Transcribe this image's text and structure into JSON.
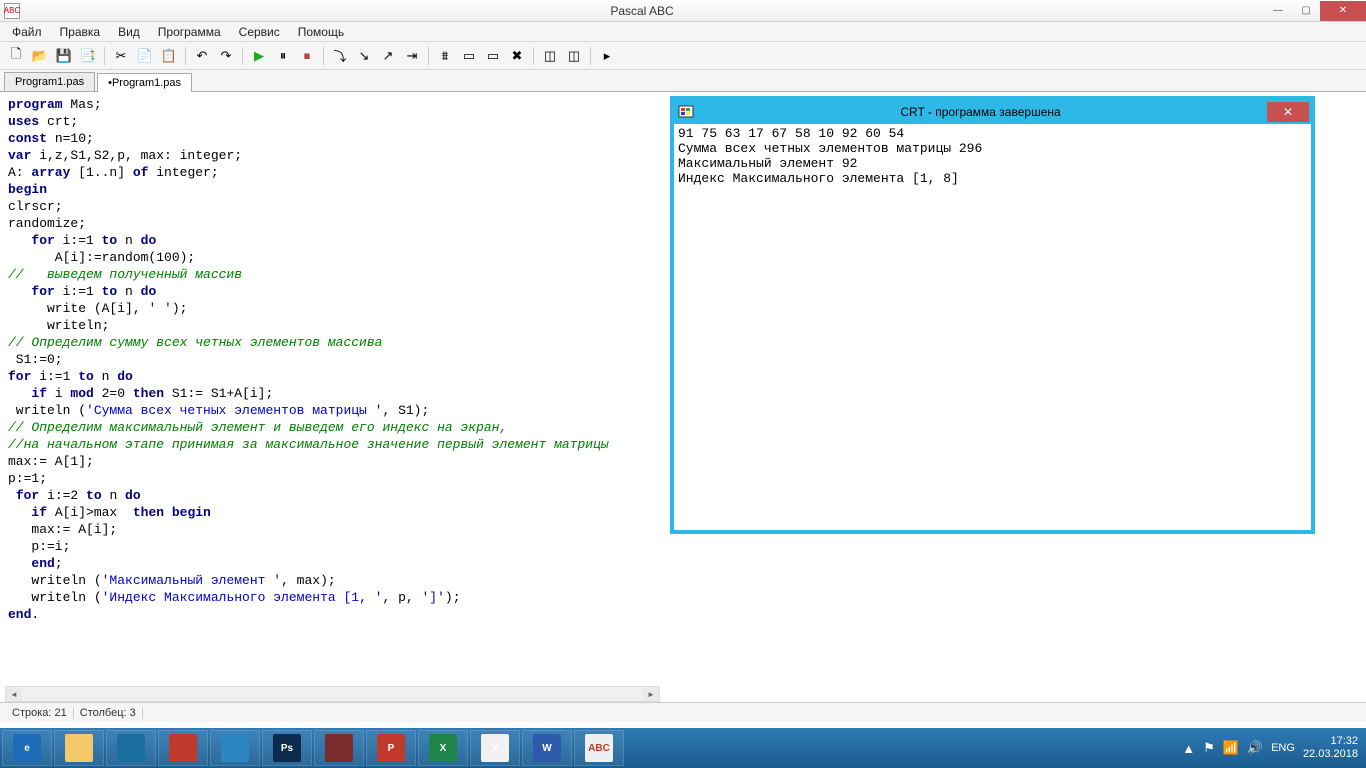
{
  "window": {
    "title": "Pascal ABC",
    "icon_label": "ABC"
  },
  "menu": [
    "Файл",
    "Правка",
    "Вид",
    "Программа",
    "Сервис",
    "Помощь"
  ],
  "tabs": [
    {
      "label": "Program1.pas",
      "active": false
    },
    {
      "label": "•Program1.pas",
      "active": true
    }
  ],
  "code_lines": [
    {
      "t": "program Mas;",
      "cls": "kw-mix",
      "raw": "<span class='kw'>program</span> Mas;"
    },
    {
      "raw": "<span class='kw'>uses</span> crt;"
    },
    {
      "raw": "<span class='kw'>const</span> n=10;"
    },
    {
      "raw": "<span class='kw'>var</span> i,z,S1,S2,p, max: integer;"
    },
    {
      "raw": "A: <span class='kw'>array</span> [1..n] <span class='kw'>of</span> integer;"
    },
    {
      "raw": "<span class='kw'>begin</span>"
    },
    {
      "raw": "clrscr;"
    },
    {
      "raw": "randomize;"
    },
    {
      "raw": "   <span class='kw'>for</span> i:=1 <span class='kw'>to</span> n <span class='kw'>do</span>"
    },
    {
      "raw": "      A[i]:=random(100);"
    },
    {
      "raw": "<span class='cm'>//   выведем полученный массив</span>"
    },
    {
      "raw": "   <span class='kw'>for</span> i:=1 <span class='kw'>to</span> n <span class='kw'>do</span>"
    },
    {
      "raw": "     write (A[i], <span class='st'>' '</span>);"
    },
    {
      "raw": "     writeln;"
    },
    {
      "raw": "<span class='cm'>// Определим сумму всех четных элементов массива</span>"
    },
    {
      "raw": " S1:=0;"
    },
    {
      "raw": "<span class='kw'>for</span> i:=1 <span class='kw'>to</span> n <span class='kw'>do</span>"
    },
    {
      "raw": "   <span class='kw'>if</span> i <span class='kw'>mod</span> 2=0 <span class='kw'>then</span> S1:= S1+A[i];"
    },
    {
      "raw": " writeln (<span class='st'>'Сумма всех четных элементов матрицы '</span>, S1);"
    },
    {
      "raw": "<span class='cm'>// Определим максимальный элемент и выведем его индекс на экран,</span>"
    },
    {
      "raw": "<span class='cm'>//на начальном этапе принимая за максимальное значение первый элемент матрицы</span>"
    },
    {
      "raw": "max:= A[1];"
    },
    {
      "raw": "p:=1;"
    },
    {
      "raw": " <span class='kw'>for</span> i:=2 <span class='kw'>to</span> n <span class='kw'>do</span>"
    },
    {
      "raw": "   <span class='kw'>if</span> A[i]&gt;max  <span class='kw'>then begin</span>"
    },
    {
      "raw": "   max:= A[i];"
    },
    {
      "raw": "   p:=i;"
    },
    {
      "raw": "   <span class='kw'>end</span>;"
    },
    {
      "raw": "   writeln (<span class='st'>'Максимальный элемент '</span>, max);"
    },
    {
      "raw": "   writeln (<span class='st'>'Индекс Максимального элемента [1, '</span>, p, <span class='st'>']'</span>);"
    },
    {
      "raw": "<span class='kw'>end</span>."
    }
  ],
  "crt": {
    "title": "CRT - программа завершена",
    "lines": [
      "91 75 63 17 67 58 10 92 60 54",
      "Сумма всех четных элементов матрицы 296",
      "Максимальный элемент 92",
      "Индекс Максимального элемента [1, 8]"
    ]
  },
  "status": {
    "line_label": "Строка: 21",
    "col_label": "Столбец: 3"
  },
  "tray": {
    "lang": "ENG",
    "time": "17:32",
    "date": "22.03.2018"
  },
  "toolbar_icons": [
    "new",
    "open",
    "save",
    "saveall",
    "|",
    "cut",
    "copy",
    "paste",
    "|",
    "undo",
    "redo",
    "|",
    "run",
    "pause",
    "stop",
    "|",
    "stepover",
    "stepin",
    "stepout",
    "stepto",
    "|",
    "vars",
    "watch",
    "breaks",
    "breakdel",
    "|",
    "win1",
    "win2",
    "|",
    "ex"
  ],
  "task_apps": [
    "ie",
    "explorer",
    "wmp",
    "power",
    "desktop",
    "ps",
    "unknown",
    "pp",
    "excel",
    "ya",
    "word",
    "abc"
  ]
}
